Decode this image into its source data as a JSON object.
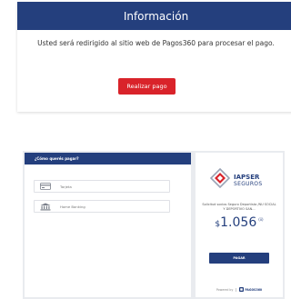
{
  "info_modal": {
    "title": "Información",
    "message": "Usted será redirigido al sitio web de Pagos360 para procesar el pago.",
    "button_label": "Realizar pago"
  },
  "payment_widget": {
    "header": "¿Cómo querés pagar?",
    "methods": [
      {
        "label": "Tarjeta",
        "icon": "credit-card-icon"
      },
      {
        "label": "Home Banking",
        "icon": "bank-icon"
      }
    ],
    "merchant": {
      "brand": "IAPSER",
      "brand_sub": "SEGUROS"
    },
    "concept": "Solicitud socios Seguro Deportista /NU SOCIAL Y DEPORTIVO SAN...",
    "amount": {
      "currency": "$",
      "value": "1.056",
      "superscript": "(ii)"
    },
    "pay_button": "PAGAR",
    "footer": {
      "powered_by": "Powered by",
      "brand": "PAGOS360"
    }
  },
  "colors": {
    "primary": "#243f7d",
    "accent": "#d9232a",
    "frame": "#e9ebef"
  }
}
